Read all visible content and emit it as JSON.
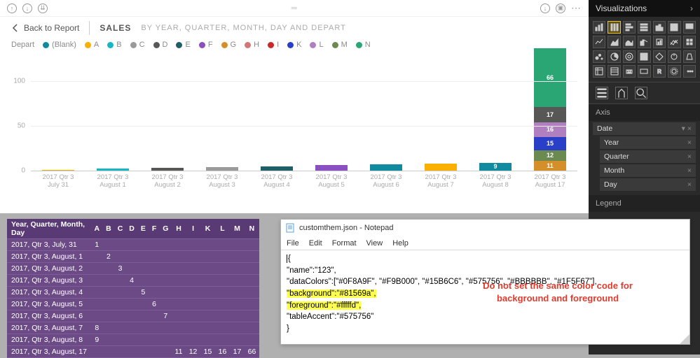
{
  "toolbar": {
    "back": "Back to Report"
  },
  "header": {
    "title": "SALES",
    "subtitle": "BY YEAR, QUARTER, MONTH, DAY AND DEPART"
  },
  "legend": {
    "label": "Depart",
    "items": [
      {
        "name": "(Blank)",
        "color": "#0F8A9F"
      },
      {
        "name": "A",
        "color": "#F9B000"
      },
      {
        "name": "B",
        "color": "#15B6C6"
      },
      {
        "name": "C",
        "color": "#9a9a9a"
      },
      {
        "name": "D",
        "color": "#575756"
      },
      {
        "name": "E",
        "color": "#1F5F67"
      },
      {
        "name": "F",
        "color": "#8a4fc0"
      },
      {
        "name": "G",
        "color": "#d48f2a"
      },
      {
        "name": "H",
        "color": "#d47575"
      },
      {
        "name": "I",
        "color": "#c82a2a"
      },
      {
        "name": "K",
        "color": "#2a3fc8"
      },
      {
        "name": "L",
        "color": "#b07fc0"
      },
      {
        "name": "M",
        "color": "#6a8a50"
      },
      {
        "name": "N",
        "color": "#2aa574"
      }
    ]
  },
  "chart_data": {
    "type": "bar",
    "ylabel": "",
    "ylim": [
      0,
      130
    ],
    "yticks": [
      0,
      50,
      100
    ],
    "categories": [
      "2017 Qtr 3 July 31",
      "2017 Qtr 3 August 1",
      "2017 Qtr 3 August 2",
      "2017 Qtr 3 August 3",
      "2017 Qtr 3 August 4",
      "2017 Qtr 3 August 5",
      "2017 Qtr 3 August 6",
      "2017 Qtr 3 August 7",
      "2017 Qtr 3 August 8",
      "2017 Qtr 3 August 17"
    ],
    "bars": [
      {
        "segments": [
          {
            "v": 1,
            "c": "#F9B000"
          }
        ]
      },
      {
        "segments": [
          {
            "v": 2,
            "c": "#15B6C6"
          }
        ]
      },
      {
        "segments": [
          {
            "v": 3,
            "c": "#575756"
          }
        ]
      },
      {
        "segments": [
          {
            "v": 4,
            "c": "#9a9a9a"
          }
        ]
      },
      {
        "segments": [
          {
            "v": 5,
            "c": "#1F5F67"
          }
        ]
      },
      {
        "segments": [
          {
            "v": 6,
            "c": "#8a4fc0"
          }
        ]
      },
      {
        "segments": [
          {
            "v": 7,
            "c": "#0F8A9F"
          }
        ]
      },
      {
        "segments": [
          {
            "v": 8,
            "c": "#F9B000"
          }
        ]
      },
      {
        "segments": [
          {
            "v": 9,
            "c": "#0F8A9F",
            "label": "9"
          }
        ]
      },
      {
        "segments": [
          {
            "v": 11,
            "c": "#d48f2a",
            "label": "11"
          },
          {
            "v": 12,
            "c": "#6a8a50",
            "label": "12"
          },
          {
            "v": 15,
            "c": "#2a3fc8",
            "label": "15"
          },
          {
            "v": 16,
            "c": "#b07fc0",
            "label": "16"
          },
          {
            "v": 17,
            "c": "#575756",
            "label": "17"
          },
          {
            "v": 66,
            "c": "#2aa574",
            "label": "66"
          }
        ]
      }
    ]
  },
  "matrix": {
    "header": [
      "Year, Quarter, Month, Day",
      "A",
      "B",
      "C",
      "D",
      "E",
      "F",
      "G",
      "H",
      "I",
      "K",
      "L",
      "M",
      "N"
    ],
    "rows": [
      {
        "label": "2017, Qtr 3, July, 31",
        "cells": {
          "A": "1"
        }
      },
      {
        "label": "2017, Qtr 3, August, 1",
        "cells": {
          "B": "2"
        }
      },
      {
        "label": "2017, Qtr 3, August, 2",
        "cells": {
          "C": "3"
        }
      },
      {
        "label": "2017, Qtr 3, August, 3",
        "cells": {
          "D": "4"
        }
      },
      {
        "label": "2017, Qtr 3, August, 4",
        "cells": {
          "E": "5"
        }
      },
      {
        "label": "2017, Qtr 3, August, 5",
        "cells": {
          "F": "6"
        }
      },
      {
        "label": "2017, Qtr 3, August, 6",
        "cells": {
          "G": "7"
        }
      },
      {
        "label": "2017, Qtr 3, August, 7",
        "cells": {
          "A": "8"
        }
      },
      {
        "label": "2017, Qtr 3, August, 8",
        "cells": {
          "A": "9"
        }
      },
      {
        "label": "2017, Qtr 3, August, 17",
        "cells": {
          "H": "11",
          "I": "12",
          "K": "15",
          "L": "16",
          "M": "17",
          "N": "66"
        }
      }
    ]
  },
  "notepad": {
    "title": "customthem.json - Notepad",
    "menu": [
      "File",
      "Edit",
      "Format",
      "View",
      "Help"
    ],
    "body": {
      "l1": "{",
      "l2": "\"name\":\"123\",",
      "l3": "\"dataColors\":[\"#0F8A9F\", \"#F9B000\", \"#15B6C6\", \"#575756\", \"#BBBBBB\", \"#1F5F67\"],",
      "l4": "\"background\":\"#81569a\",",
      "l5": "\"foreground\":\"#fffffd\",",
      "l6": "\"tableAccent\":\"#575756\"",
      "l7": "}"
    },
    "warning": "Do not set the same color code for background and foreground"
  },
  "viz": {
    "title": "Visualizations",
    "axis_label": "Axis",
    "legend_label": "Legend",
    "fields": [
      {
        "name": "Date",
        "sub": false,
        "caret": true
      },
      {
        "name": "Year",
        "sub": true
      },
      {
        "name": "Quarter",
        "sub": true
      },
      {
        "name": "Month",
        "sub": true
      },
      {
        "name": "Day",
        "sub": true
      }
    ]
  }
}
